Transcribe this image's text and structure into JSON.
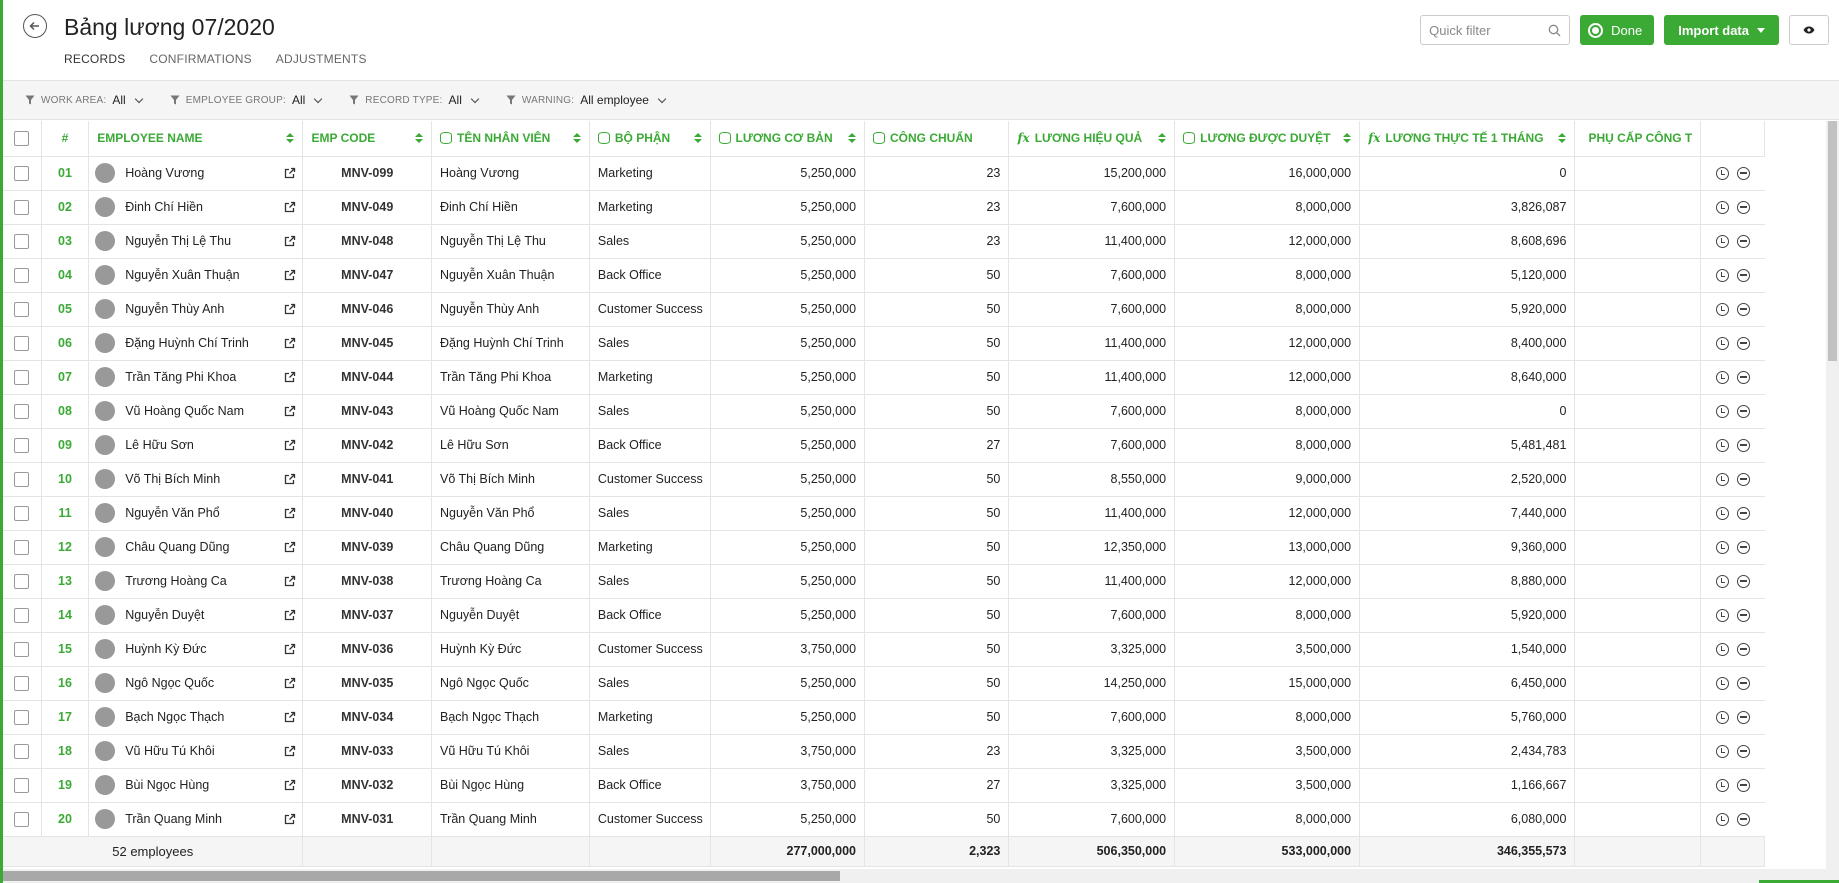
{
  "title": "Bảng lương 07/2020",
  "tabs": [
    "RECORDS",
    "CONFIRMATIONS",
    "ADJUSTMENTS"
  ],
  "quick_filter": {
    "placeholder": "Quick filter"
  },
  "buttons": {
    "done": "Done",
    "import": "Import data"
  },
  "filters": [
    {
      "label": "WORK AREA:",
      "value": "All"
    },
    {
      "label": "EMPLOYEE GROUP:",
      "value": "All"
    },
    {
      "label": "RECORD TYPE:",
      "value": "All"
    },
    {
      "label": "WARNING:",
      "value": "All employee"
    }
  ],
  "columns": {
    "num": "#",
    "name": "EMPLOYEE NAME",
    "code": "EMP CODE",
    "ten_nv": "TÊN NHÂN VIÊN",
    "bo_phan": "BỘ PHẬN",
    "luong_cb": "LƯƠNG CƠ BẢN",
    "cong_chuan": "CÔNG CHUẨN",
    "luong_hq": "LƯƠNG HIỆU QUẢ",
    "luong_dd": "LƯƠNG ĐƯỢC DUYỆT",
    "luong_tt": "LƯƠNG THỰC TẾ 1 THÁNG",
    "phu_cap": "PHỤ CẤP CÔNG T"
  },
  "rows": [
    {
      "num": "01",
      "name": "Hoàng Vương",
      "code": "MNV-099",
      "dept": "Marketing",
      "base": "5,250,000",
      "days": "23",
      "perf": "15,200,000",
      "approved": "16,000,000",
      "actual": "0"
    },
    {
      "num": "02",
      "name": "Đinh Chí Hiền",
      "code": "MNV-049",
      "dept": "Marketing",
      "base": "5,250,000",
      "days": "23",
      "perf": "7,600,000",
      "approved": "8,000,000",
      "actual": "3,826,087"
    },
    {
      "num": "03",
      "name": "Nguyễn Thị Lệ Thu",
      "code": "MNV-048",
      "dept": "Sales",
      "base": "5,250,000",
      "days": "23",
      "perf": "11,400,000",
      "approved": "12,000,000",
      "actual": "8,608,696"
    },
    {
      "num": "04",
      "name": "Nguyễn Xuân Thuận",
      "code": "MNV-047",
      "dept": "Back Office",
      "base": "5,250,000",
      "days": "50",
      "perf": "7,600,000",
      "approved": "8,000,000",
      "actual": "5,120,000"
    },
    {
      "num": "05",
      "name": "Nguyễn Thùy Anh",
      "code": "MNV-046",
      "dept": "Customer Success",
      "base": "5,250,000",
      "days": "50",
      "perf": "7,600,000",
      "approved": "8,000,000",
      "actual": "5,920,000"
    },
    {
      "num": "06",
      "name": "Đặng Huỳnh Chí Trinh",
      "code": "MNV-045",
      "dept": "Sales",
      "base": "5,250,000",
      "days": "50",
      "perf": "11,400,000",
      "approved": "12,000,000",
      "actual": "8,400,000"
    },
    {
      "num": "07",
      "name": "Trần Tăng Phi Khoa",
      "code": "MNV-044",
      "dept": "Marketing",
      "base": "5,250,000",
      "days": "50",
      "perf": "11,400,000",
      "approved": "12,000,000",
      "actual": "8,640,000"
    },
    {
      "num": "08",
      "name": "Vũ Hoàng Quốc Nam",
      "code": "MNV-043",
      "dept": "Sales",
      "base": "5,250,000",
      "days": "50",
      "perf": "7,600,000",
      "approved": "8,000,000",
      "actual": "0"
    },
    {
      "num": "09",
      "name": "Lê Hữu Sơn",
      "code": "MNV-042",
      "dept": "Back Office",
      "base": "5,250,000",
      "days": "27",
      "perf": "7,600,000",
      "approved": "8,000,000",
      "actual": "5,481,481"
    },
    {
      "num": "10",
      "name": "Võ Thị Bích Minh",
      "code": "MNV-041",
      "dept": "Customer Success",
      "base": "5,250,000",
      "days": "50",
      "perf": "8,550,000",
      "approved": "9,000,000",
      "actual": "2,520,000"
    },
    {
      "num": "11",
      "name": "Nguyễn Văn Phổ",
      "code": "MNV-040",
      "dept": "Sales",
      "base": "5,250,000",
      "days": "50",
      "perf": "11,400,000",
      "approved": "12,000,000",
      "actual": "7,440,000"
    },
    {
      "num": "12",
      "name": "Châu Quang Dũng",
      "code": "MNV-039",
      "dept": "Marketing",
      "base": "5,250,000",
      "days": "50",
      "perf": "12,350,000",
      "approved": "13,000,000",
      "actual": "9,360,000"
    },
    {
      "num": "13",
      "name": "Trương Hoàng Ca",
      "code": "MNV-038",
      "dept": "Sales",
      "base": "5,250,000",
      "days": "50",
      "perf": "11,400,000",
      "approved": "12,000,000",
      "actual": "8,880,000"
    },
    {
      "num": "14",
      "name": "Nguyễn Duyệt",
      "code": "MNV-037",
      "dept": "Back Office",
      "base": "5,250,000",
      "days": "50",
      "perf": "7,600,000",
      "approved": "8,000,000",
      "actual": "5,920,000"
    },
    {
      "num": "15",
      "name": "Huỳnh Kỳ Đức",
      "code": "MNV-036",
      "dept": "Customer Success",
      "base": "3,750,000",
      "days": "50",
      "perf": "3,325,000",
      "approved": "3,500,000",
      "actual": "1,540,000"
    },
    {
      "num": "16",
      "name": "Ngô Ngọc Quốc",
      "code": "MNV-035",
      "dept": "Sales",
      "base": "5,250,000",
      "days": "50",
      "perf": "14,250,000",
      "approved": "15,000,000",
      "actual": "6,450,000"
    },
    {
      "num": "17",
      "name": "Bạch Ngọc Thạch",
      "code": "MNV-034",
      "dept": "Marketing",
      "base": "5,250,000",
      "days": "50",
      "perf": "7,600,000",
      "approved": "8,000,000",
      "actual": "5,760,000"
    },
    {
      "num": "18",
      "name": "Vũ Hữu Tú Khôi",
      "code": "MNV-033",
      "dept": "Sales",
      "base": "3,750,000",
      "days": "23",
      "perf": "3,325,000",
      "approved": "3,500,000",
      "actual": "2,434,783"
    },
    {
      "num": "19",
      "name": "Bùi Ngọc Hùng",
      "code": "MNV-032",
      "dept": "Back Office",
      "base": "3,750,000",
      "days": "27",
      "perf": "3,325,000",
      "approved": "3,500,000",
      "actual": "1,166,667"
    },
    {
      "num": "20",
      "name": "Trần Quang Minh",
      "code": "MNV-031",
      "dept": "Customer Success",
      "base": "5,250,000",
      "days": "50",
      "perf": "7,600,000",
      "approved": "8,000,000",
      "actual": "6,080,000"
    }
  ],
  "totals": {
    "count": "52 employees",
    "base": "277,000,000",
    "days": "2,323",
    "perf": "506,350,000",
    "approved": "533,000,000",
    "actual": "346,355,573"
  },
  "colors": {
    "accent": "#3aaa35"
  }
}
